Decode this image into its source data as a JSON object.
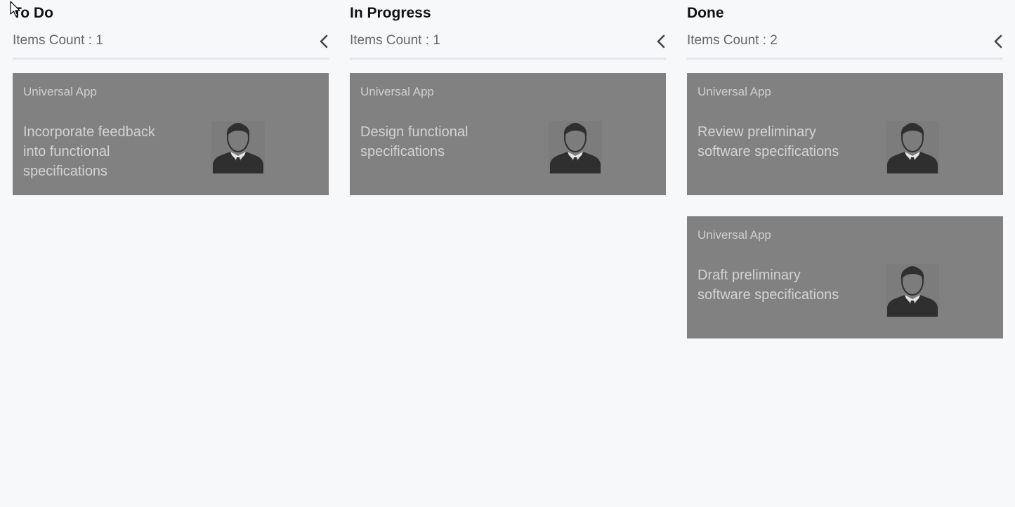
{
  "columns": [
    {
      "title": "To Do",
      "count_text": "Items Count : 1",
      "cards": [
        {
          "category": "Universal App",
          "title": "Incorporate feedback into functional specifications"
        }
      ]
    },
    {
      "title": "In Progress",
      "count_text": "Items Count : 1",
      "cards": [
        {
          "category": "Universal App",
          "title": "Design functional specifications"
        }
      ]
    },
    {
      "title": "Done",
      "count_text": "Items Count : 2",
      "cards": [
        {
          "category": "Universal App",
          "title": "Review preliminary software specifications"
        },
        {
          "category": "Universal App",
          "title": "Draft preliminary software specifications"
        }
      ]
    }
  ],
  "icons": {
    "collapse": "chevron-left-icon",
    "assignee": "person-icon",
    "pointer": "mouse-pointer-icon"
  },
  "colors": {
    "background": "#f7f8fa",
    "card": "#818181",
    "card_text": "#d3d3d3",
    "avatar": "#2f2f2f"
  }
}
